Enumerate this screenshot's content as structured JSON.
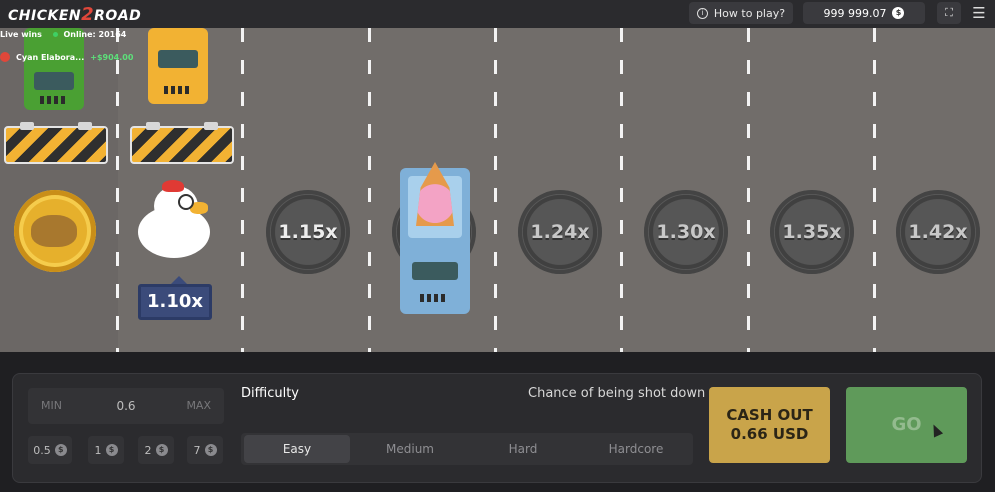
{
  "header": {
    "logo_text_left": "CHICKEN",
    "logo_text_mid": "2",
    "logo_text_right": "ROAD",
    "how_to_play_label": "How to play?",
    "balance": "999 999.07",
    "currency_symbol": "$"
  },
  "live_wins": {
    "label": "Live wins",
    "online_label": "Online: 20164",
    "entry": {
      "name": "Cyan Elabora...",
      "amount": "+$904.00"
    }
  },
  "lanes": {
    "chicken_multiplier": "1.10x",
    "multipliers": [
      "1.15x",
      "1.24x",
      "1.30x",
      "1.35x",
      "1.42x"
    ]
  },
  "bet": {
    "min_label": "MIN",
    "max_label": "MAX",
    "value": "0.6",
    "quick_amounts": [
      "0.5",
      "1",
      "2",
      "7"
    ]
  },
  "difficulty": {
    "label": "Difficulty",
    "chance_label": "Chance of being shot down",
    "options": [
      "Easy",
      "Medium",
      "Hard",
      "Hardcore"
    ],
    "selected": "Easy"
  },
  "actions": {
    "cashout_line1": "CASH OUT",
    "cashout_line2": "0.66 USD",
    "go_label": "GO"
  },
  "colors": {
    "road": "#716d6a",
    "cashout": "#c9a44a",
    "go": "#5f9a5a",
    "chicken_tag": "#3b4b7a"
  }
}
